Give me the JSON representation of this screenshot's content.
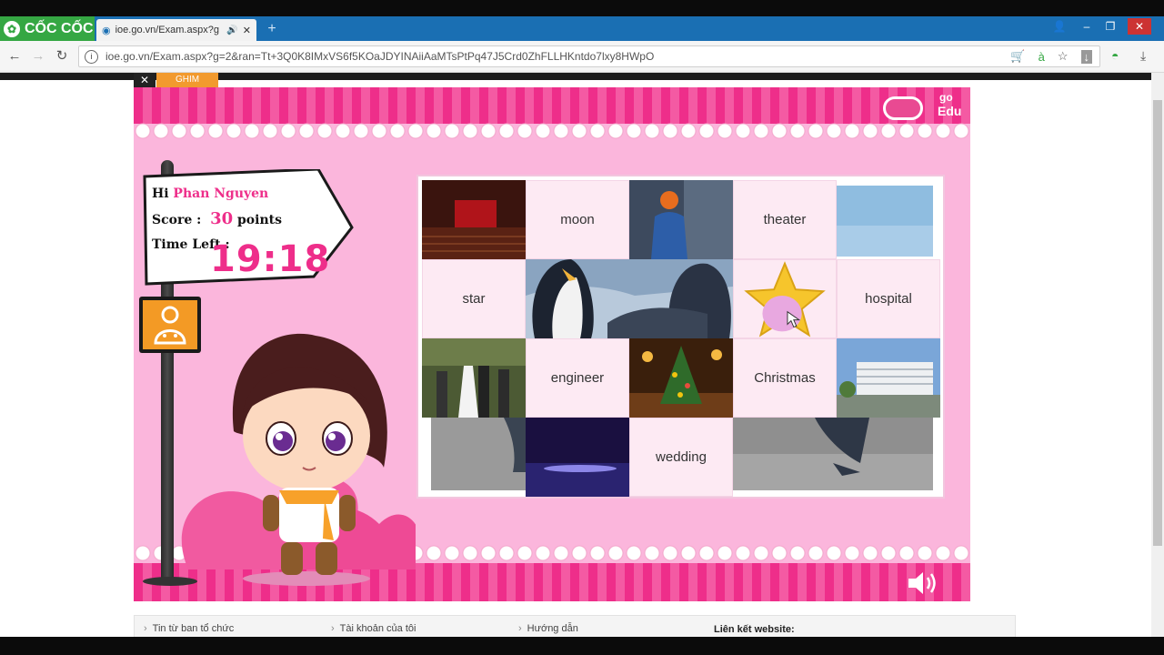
{
  "browser": {
    "brand": "CỐC CỐC",
    "tab_title": "ioe.go.vn/Exam.aspx?g",
    "url": "ioe.go.vn/Exam.aspx?g=2&ran=Tt+3Q0K8IMxVS6f5KOaJDYINAiiAaMTsPtPq47J5Crd0ZhFLLHKntdo7lxy8HWpO"
  },
  "pin": {
    "ghim": "GHIM"
  },
  "logo": {
    "go": "go",
    "edu": "Edu"
  },
  "player": {
    "hi": "Hi",
    "name": "Phan Nguyen",
    "score_label": "Score :",
    "score": "30",
    "points": "points",
    "time_label": "Time Left :",
    "time": "19:18"
  },
  "board": {
    "words": {
      "moon": "moon",
      "theater": "theater",
      "star": "star",
      "hospital": "hospital",
      "engineer": "engineer",
      "christmas": "Christmas",
      "wedding": "wedding"
    }
  },
  "footer": {
    "link1": "Tin từ ban tổ chức",
    "link2": "Tài khoản của tôi",
    "link3": "Hướng dẫn",
    "link4": "Liên kết website:"
  },
  "colors": {
    "accent_pink": "#ee2e8a",
    "bg_pink": "#fbb6dc",
    "orange": "#f39a25",
    "browser_blue": "#1a6fb3"
  }
}
